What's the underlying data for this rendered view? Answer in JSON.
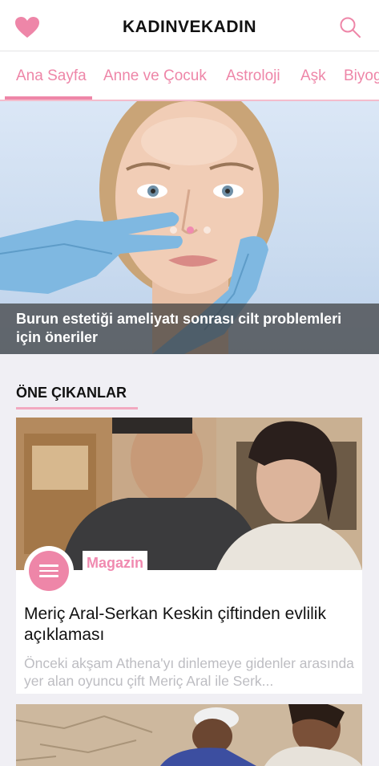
{
  "header": {
    "title": "KADINVEKADIN",
    "left_icon": "heart-icon",
    "right_icon": "search-icon"
  },
  "tabs": [
    {
      "label": "Ana Sayfa",
      "active": true
    },
    {
      "label": "Anne ve Çocuk",
      "active": false
    },
    {
      "label": "Astroloji",
      "active": false
    },
    {
      "label": "Aşk",
      "active": false
    },
    {
      "label": "Biyog",
      "active": false
    }
  ],
  "hero": {
    "caption": "Burun estetiği ameliyatı sonrası cilt problemleri için öneriler",
    "slide_count": 3,
    "active_slide": 2
  },
  "featured": {
    "section_title": "ÖNE ÇIKANLAR",
    "cards": [
      {
        "category": "Magazin",
        "title": "Meriç Aral-Serkan Keskin çiftinden evlilik açıklaması",
        "excerpt": "Önceki akşam Athena'yı dinlemeye gidenler arasında yer alan oyuncu çift Meriç Aral ile Serk..."
      }
    ]
  },
  "colors": {
    "accent": "#ee86a8",
    "accent_light": "#f4bccc",
    "background": "#f0eff4",
    "excerpt_gray": "#bdbdc2"
  }
}
